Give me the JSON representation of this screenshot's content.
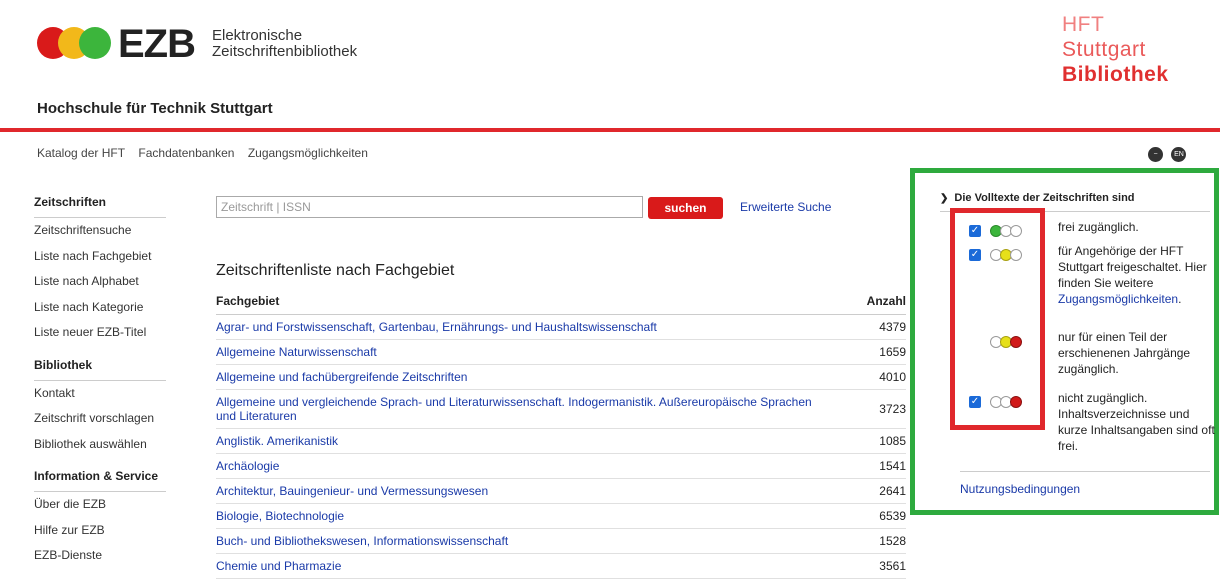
{
  "header": {
    "logo_text": "EZB",
    "logo_sub1": "Elektronische",
    "logo_sub2": "Zeitschriftenbibliothek",
    "institution": "Hochschule für Technik Stuttgart",
    "hft_line1": "HFT",
    "hft_line2": "Stuttgart",
    "hft_line3": "Bibliothek"
  },
  "topnav": [
    "Katalog der HFT",
    "Fachdatenbanken",
    "Zugangsmöglichkeiten"
  ],
  "topicons": {
    "a": "minus-circle-icon",
    "b": "EN"
  },
  "sidebar": {
    "sections": [
      {
        "title": "Zeitschriften",
        "items": [
          "Zeitschriftensuche",
          "Liste nach Fachgebiet",
          "Liste nach Alphabet",
          "Liste nach Kategorie",
          "Liste neuer EZB-Titel"
        ]
      },
      {
        "title": "Bibliothek",
        "items": [
          "Kontakt",
          "Zeitschrift vorschlagen",
          "Bibliothek auswählen"
        ]
      },
      {
        "title": "Information & Service",
        "items": [
          "Über die EZB",
          "Hilfe zur EZB",
          "EZB-Dienste"
        ]
      }
    ]
  },
  "search": {
    "placeholder": "Zeitschrift | ISSN",
    "button": "suchen",
    "advanced": "Erweiterte Suche"
  },
  "list": {
    "title": "Zeitschriftenliste nach Fachgebiet",
    "col_subject": "Fachgebiet",
    "col_count": "Anzahl",
    "rows": [
      {
        "name": "Agrar- und Forstwissenschaft, Gartenbau, Ernährungs- und Haushaltswissenschaft",
        "count": "4379"
      },
      {
        "name": "Allgemeine Naturwissenschaft",
        "count": "1659"
      },
      {
        "name": "Allgemeine und fachübergreifende Zeitschriften",
        "count": "4010"
      },
      {
        "name": "Allgemeine und vergleichende Sprach- und Literaturwissenschaft. Indogermanistik. Außereuropäische Sprachen und Literaturen",
        "count": "3723"
      },
      {
        "name": "Anglistik. Amerikanistik",
        "count": "1085"
      },
      {
        "name": "Archäologie",
        "count": "1541"
      },
      {
        "name": "Architektur, Bauingenieur- und Vermessungswesen",
        "count": "2641"
      },
      {
        "name": "Biologie, Biotechnologie",
        "count": "6539"
      },
      {
        "name": "Buch- und Bibliothekswesen, Informationswissenschaft",
        "count": "1528"
      },
      {
        "name": "Chemie und Pharmazie",
        "count": "3561"
      }
    ]
  },
  "panel": {
    "title": "Die Volltexte der Zeitschriften sind",
    "free": "frei zugänglich.",
    "licensed_1": "für Angehörige der HFT Stuttgart freigeschaltet. Hier finden Sie weitere",
    "licensed_link": "Zugangsmöglichkeiten",
    "partial": "nur für einen Teil der erschienenen Jahrgänge zugänglich.",
    "closed": "nicht zugänglich. Inhaltsverzeichnisse und kurze Inhaltsangaben sind oft frei.",
    "terms": "Nutzungsbedingungen",
    "colors": {
      "green": "#3cb53c",
      "yellow": "#e6e01a",
      "red": "#d11a1a",
      "highlight_green": "#2eaa3e",
      "highlight_red": "#e0282c"
    }
  }
}
